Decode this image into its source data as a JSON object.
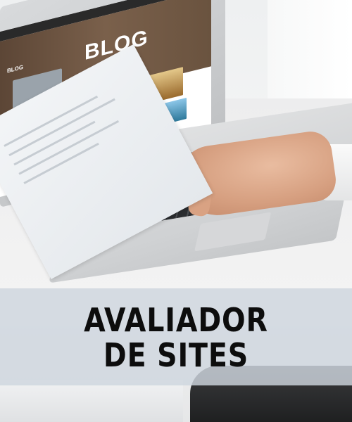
{
  "screen": {
    "brand": "BLOG",
    "hero_title": "BLOG"
  },
  "banner": {
    "line1": "AVALIADOR",
    "line2": "DE SITES",
    "background_color": "#ced6de",
    "text_color": "#0d0d0d"
  }
}
